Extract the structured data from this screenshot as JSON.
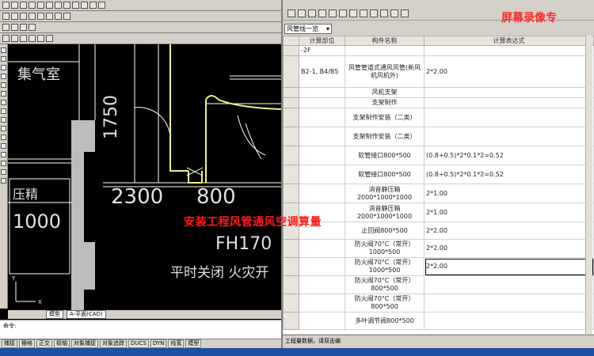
{
  "cad": {
    "tabs": [
      "模型",
      "A-平面(CAD)"
    ],
    "command_line": "命令:",
    "status_items": [
      "捕捉",
      "栅格",
      "正交",
      "极轴",
      "对象捕捉",
      "对象追踪",
      "DUCS",
      "DYN",
      "线宽",
      "模型"
    ],
    "drawing": {
      "labels": {
        "room": "集气室",
        "dim_vertical": "1750",
        "dim_2300": "2300",
        "dim_800": "800",
        "rect_label": "压精",
        "dim_1000": "1000",
        "fh_label": "FH170",
        "bottom_note": "平时关闭 火灾开"
      },
      "colors": {
        "wall": "#bdbdbd",
        "duct": "#f0f080",
        "line": "#ffffff"
      }
    }
  },
  "sheet": {
    "selector_value": "风管线一览",
    "columns": [
      "",
      "计算部位",
      "构件名称",
      "计算表达式"
    ],
    "rows": [
      {
        "n": "",
        "part": "-2F",
        "name": "",
        "expr": ""
      },
      {
        "n": "",
        "part": "B2-1, B4/B5",
        "name": "风管管道式通风风管(新风机风机外)",
        "expr": "2*2.00"
      },
      {
        "n": "",
        "part": "",
        "name": "风机支架",
        "expr": ""
      },
      {
        "n": "",
        "part": "",
        "name": "支架制作",
        "expr": ""
      },
      {
        "n": "",
        "part": "",
        "name": "支架制作安装（二类）",
        "expr": ""
      },
      {
        "n": "",
        "part": "",
        "name": "支架制作安装（二类）",
        "expr": ""
      },
      {
        "n": "",
        "part": "",
        "name": "软管接口800*500",
        "expr": "(0.8+0.5)*2*0.1*2=0.52"
      },
      {
        "n": "",
        "part": "",
        "name": "软管接口800*500",
        "expr": "(0.8+0.5)*2*0.1*2=0.52"
      },
      {
        "n": "",
        "part": "",
        "name": "消音静压箱2000*1000*1000",
        "expr": "2*1.00"
      },
      {
        "n": "",
        "part": "",
        "name": "消音静压箱2000*1000*1000",
        "expr": "2*1.00"
      },
      {
        "n": "",
        "part": "",
        "name": "止回阀800*500",
        "expr": "2*2.00"
      },
      {
        "n": "",
        "part": "",
        "name": "防火阀70°C（常开）1000*500",
        "expr": "2*2.00"
      },
      {
        "n": "",
        "part": "",
        "name": "防火阀70°C（常开）1000*500",
        "expr": "2*2.00"
      },
      {
        "n": "",
        "part": "",
        "name": "防火阀70°C（常开）800*500",
        "expr": ""
      },
      {
        "n": "",
        "part": "",
        "name": "防火阀70°C（常开）800*500",
        "expr": ""
      },
      {
        "n": "",
        "part": "",
        "name": "多叶调节阀800*500",
        "expr": ""
      }
    ],
    "status_text": "工程量数据，请双击编"
  },
  "overlay": {
    "caption": "安装工程风管通风空调算量",
    "brand": "屏幕录像专"
  }
}
